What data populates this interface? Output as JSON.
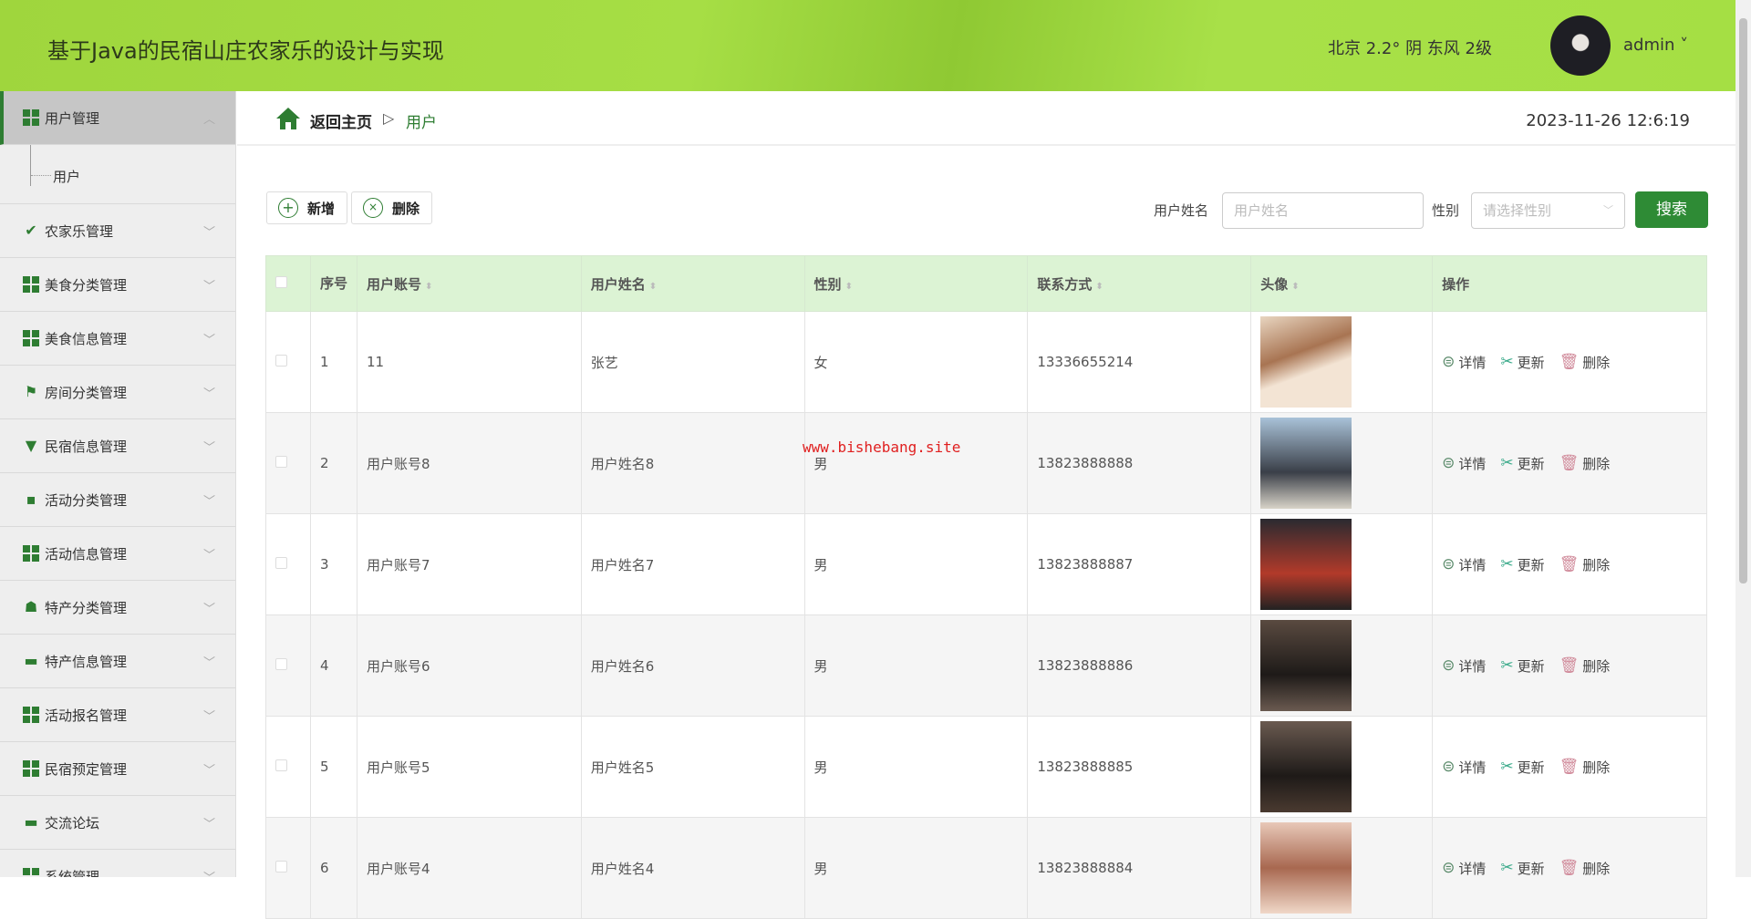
{
  "header": {
    "title": "基于Java的民宿山庄农家乐的设计与实现",
    "weather": "北京  2.2°  阴  东风  2级",
    "user": "admin ˅"
  },
  "sidebar": {
    "active": "用户管理",
    "sub": "用户",
    "items": [
      "农家乐管理",
      "美食分类管理",
      "美食信息管理",
      "房间分类管理",
      "民宿信息管理",
      "活动分类管理",
      "活动信息管理",
      "特产分类管理",
      "特产信息管理",
      "活动报名管理",
      "民宿预定管理",
      "交流论坛",
      "系统管理"
    ]
  },
  "breadcrumb": {
    "home": "返回主页",
    "sep": "▷",
    "current": "用户",
    "datetime": "2023-11-26 12:6:19"
  },
  "toolbar": {
    "add": "新增",
    "delete": "删除",
    "name_label": "用户姓名",
    "name_placeholder": "用户姓名",
    "gender_label": "性别",
    "gender_placeholder": "请选择性别",
    "search": "搜索"
  },
  "table": {
    "headers": [
      "序号",
      "用户账号",
      "用户姓名",
      "性别",
      "联系方式",
      "头像",
      "操作"
    ],
    "actions": [
      "详情",
      "更新",
      "删除"
    ],
    "rows": [
      {
        "no": "1",
        "account": "11",
        "name": "张艺",
        "gender": "女",
        "phone": "13336655214"
      },
      {
        "no": "2",
        "account": "用户账号8",
        "name": "用户姓名8",
        "gender": "男",
        "phone": "13823888888"
      },
      {
        "no": "3",
        "account": "用户账号7",
        "name": "用户姓名7",
        "gender": "男",
        "phone": "13823888887"
      },
      {
        "no": "4",
        "account": "用户账号6",
        "name": "用户姓名6",
        "gender": "男",
        "phone": "13823888886"
      },
      {
        "no": "5",
        "account": "用户账号5",
        "name": "用户姓名5",
        "gender": "男",
        "phone": "13823888885"
      },
      {
        "no": "6",
        "account": "用户账号4",
        "name": "用户姓名4",
        "gender": "男",
        "phone": "13823888884"
      }
    ]
  },
  "watermark": "www.bishebang.site"
}
